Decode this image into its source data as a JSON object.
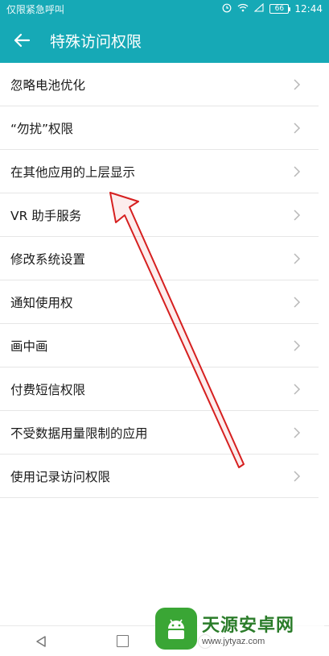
{
  "status": {
    "carrier": "仅限紧急呼叫",
    "battery": "66",
    "time": "12:44"
  },
  "header": {
    "title": "特殊访问权限",
    "back_icon": "arrow-left-icon"
  },
  "items": [
    {
      "label": "忽略电池优化"
    },
    {
      "label": "“勿扰”权限"
    },
    {
      "label": "在其他应用的上层显示"
    },
    {
      "label": "VR 助手服务"
    },
    {
      "label": "修改系统设置"
    },
    {
      "label": "通知使用权"
    },
    {
      "label": "画中画"
    },
    {
      "label": "付费短信权限"
    },
    {
      "label": "不受数据用量限制的应用"
    },
    {
      "label": "使用记录访问权限"
    }
  ],
  "watermark": {
    "title": "天源安卓网",
    "url": "www.jytyaz.com"
  },
  "colors": {
    "primary": "#16a9b6",
    "annotation": "#d61f1f"
  }
}
